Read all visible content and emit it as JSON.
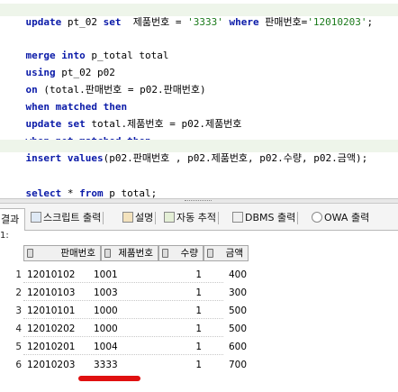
{
  "editor": {
    "line1": {
      "kw1": "update",
      "t1": " pt_02 ",
      "kw2": "set",
      "t2": "  제품번호 = ",
      "s1": "'3333'",
      "t3": " ",
      "kw3": "where",
      "t4": " 판매번호=",
      "s2": "'12010203'",
      "t5": ";"
    },
    "line2": {
      "kw1": "merge",
      "t1": " ",
      "kw2": "into",
      "t2": " p_total total"
    },
    "line3": {
      "kw1": "using",
      "t1": " pt_02 p02"
    },
    "line4": {
      "kw1": "on",
      "t1": " (total.판매번호 = p02.판매번호)"
    },
    "line5": {
      "kw1": "when",
      "t1": " ",
      "kw2": "matched",
      "t2": " ",
      "kw3": "then"
    },
    "line6": {
      "kw1": "update",
      "t1": " ",
      "kw2": "set",
      "t2": " total.제품번호 = p02.제품번호"
    },
    "line7": {
      "kw1": "when",
      "t1": " ",
      "kw2": "not",
      "t2": " ",
      "kw3": "matched",
      "t3": " ",
      "kw4": "then"
    },
    "line8": {
      "kw1": "insert",
      "t1": " ",
      "kw2": "values",
      "t2": "(p02.판매번호 , p02.제품번호, p02.수량, p02.금액);"
    },
    "line9": {
      "kw1": "select",
      "t1": " * ",
      "kw2": "from",
      "t2": " p_total;"
    }
  },
  "tabs": [
    {
      "label": "결과",
      "icon": "grid-icon"
    },
    {
      "label": "스크립트 출력",
      "icon": "script-icon"
    },
    {
      "label": "설명",
      "icon": "explain-icon"
    },
    {
      "label": "자동 추적",
      "icon": "autotrace-icon"
    },
    {
      "label": "DBMS 출력",
      "icon": "dbms-icon"
    },
    {
      "label": "OWA 출력",
      "icon": "owa-icon"
    }
  ],
  "results": {
    "stub": "1:",
    "columns": [
      "판매번호",
      "제품번호",
      "수량",
      "금액"
    ],
    "rows": [
      {
        "n": "1",
        "c1": "12010102",
        "c2": "1001",
        "c3": "1",
        "c4": "400"
      },
      {
        "n": "2",
        "c1": "12010103",
        "c2": "1003",
        "c3": "1",
        "c4": "300"
      },
      {
        "n": "3",
        "c1": "12010101",
        "c2": "1000",
        "c3": "1",
        "c4": "500"
      },
      {
        "n": "4",
        "c1": "12010202",
        "c2": "1000",
        "c3": "1",
        "c4": "500"
      },
      {
        "n": "5",
        "c1": "12010201",
        "c2": "1004",
        "c3": "1",
        "c4": "600"
      },
      {
        "n": "6",
        "c1": "12010203",
        "c2": "3333",
        "c3": "1",
        "c4": "700"
      }
    ]
  },
  "colors": {
    "keyword": "#0a1aa8",
    "string": "#1a7a1a",
    "annotation": "#e01010",
    "highlight_line": "#eef5ea"
  }
}
